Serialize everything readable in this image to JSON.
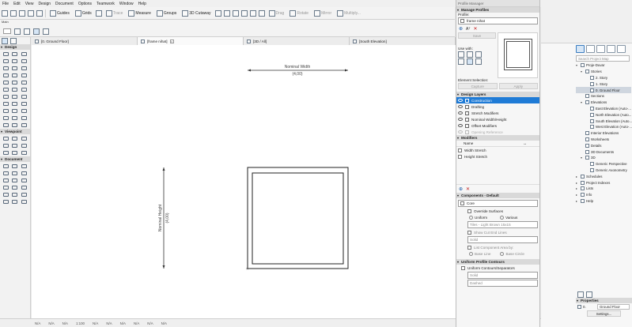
{
  "menu": [
    "File",
    "Edit",
    "View",
    "Design",
    "Document",
    "Options",
    "Teamwork",
    "Window",
    "Help"
  ],
  "toolbar": {
    "guides": "Guides",
    "grids": "Grids",
    "trace": "Trace",
    "measure": "Measure",
    "groups": "Groups",
    "cutaway": "3D Cutaway",
    "drag": "Drag",
    "rotate": "Rotate",
    "mirror": "Mirror",
    "multiply": "Multiply..."
  },
  "main_label": "Main",
  "tabs": [
    "[0. Ground Floor]",
    "[frame nihat]",
    "[3D / All]",
    "[South Elevation]"
  ],
  "toolbox": {
    "design": "Design",
    "viewpoint": "Viewpoint",
    "document": "Document"
  },
  "canvas": {
    "nominal_width_label": "Nominal Width",
    "nominal_width_value": "(4,00)",
    "nominal_height_label": "Nominal Height",
    "nominal_height_value": "(4,00)"
  },
  "status": {
    "na1": "N/A",
    "na2": "N/A",
    "na3": "N/A",
    "scale": "1:100",
    "na4": "N/A",
    "na5": "N/A",
    "na6": "N/A",
    "na7": "N/A",
    "na8": "N/A",
    "na9": "N/A"
  },
  "profile_manager": {
    "title": "Profile Manager",
    "manage_profiles": "Manage Profiles",
    "profile_label": "Profile:",
    "profile_value": "frame nihat",
    "save": "Save",
    "use_with": "Use with:",
    "element_selection": "Element Selection:",
    "capture": "Capture",
    "apply": "Apply",
    "design_layers": "Design Layers",
    "layers": [
      "Construction",
      "Drafting",
      "Stretch Modifiers",
      "Nominal Width/Height",
      "Offset Modifiers",
      "Opening Reference"
    ],
    "modifiers_head": "Modifiers",
    "name_col": "Name",
    "width_stretch": "Width Stretch",
    "height_stretch": "Height Stretch",
    "components_head": "Components - Default",
    "core": "Core",
    "override_surfaces": "Override Surfaces",
    "uniform": "Uniform",
    "various": "Various",
    "surface": "Tiles - Light Brown 15x15",
    "show_cut_end_lines": "Show Cut End Lines",
    "solid": "Solid",
    "list_component_area": "List Component Area by:",
    "base_line": "Base Line",
    "base_circle": "Base Circle",
    "uniform_profile_contours": "Uniform Profile Contours",
    "uniform_contours": "Uniform Contours/Separators",
    "solid2": "Solid",
    "dashed": "Dashed"
  },
  "navigator": {
    "search_placeholder": "Search Project Map",
    "items": [
      {
        "label": "Proje-Duvar",
        "level": 0,
        "arrow": "▾"
      },
      {
        "label": "Stories",
        "level": 1,
        "arrow": "▾"
      },
      {
        "label": "2. Story",
        "level": 2,
        "arrow": ""
      },
      {
        "label": "1. Story",
        "level": 2,
        "arrow": ""
      },
      {
        "label": "0. Ground Floor",
        "level": 2,
        "arrow": "",
        "selected": true
      },
      {
        "label": "Sections",
        "level": 1,
        "arrow": ""
      },
      {
        "label": "Elevations",
        "level": 1,
        "arrow": "▾"
      },
      {
        "label": "East Elevation (Auto-...",
        "level": 2,
        "arrow": ""
      },
      {
        "label": "North Elevation (Auto...",
        "level": 2,
        "arrow": ""
      },
      {
        "label": "South Elevation (Auto...",
        "level": 2,
        "arrow": ""
      },
      {
        "label": "West Elevation (Auto-...",
        "level": 2,
        "arrow": ""
      },
      {
        "label": "Interior Elevations",
        "level": 1,
        "arrow": ""
      },
      {
        "label": "Worksheets",
        "level": 1,
        "arrow": ""
      },
      {
        "label": "Details",
        "level": 1,
        "arrow": ""
      },
      {
        "label": "3D Documents",
        "level": 1,
        "arrow": ""
      },
      {
        "label": "3D",
        "level": 1,
        "arrow": "▾"
      },
      {
        "label": "Generic Perspective",
        "level": 2,
        "arrow": ""
      },
      {
        "label": "Generic Axonometry",
        "level": 2,
        "arrow": ""
      },
      {
        "label": "Schedules",
        "level": 0,
        "arrow": "▸"
      },
      {
        "label": "Project Indexes",
        "level": 0,
        "arrow": "▸"
      },
      {
        "label": "Lists",
        "level": 0,
        "arrow": "▸"
      },
      {
        "label": "Info",
        "level": 0,
        "arrow": "▸"
      },
      {
        "label": "Help",
        "level": 0,
        "arrow": "▸"
      }
    ],
    "properties": "Properties",
    "prop_num": "0.",
    "prop_value": "Ground Floor",
    "settings": "Settings..."
  }
}
